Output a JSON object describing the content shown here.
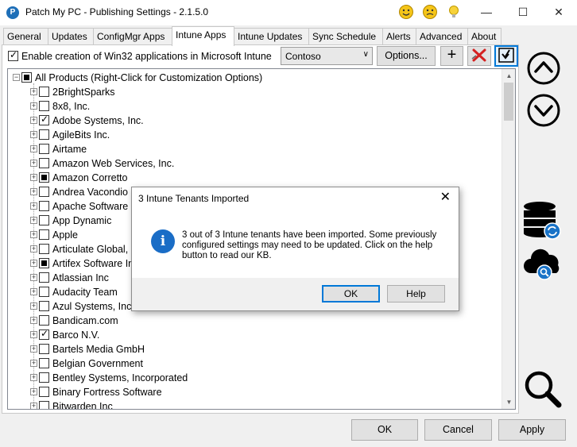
{
  "window": {
    "title": "Patch My PC - Publishing Settings - 2.1.5.0",
    "icon": "patchmypc-logo-icon",
    "controls": [
      "minimize",
      "maximize",
      "close"
    ]
  },
  "tabs": [
    {
      "label": "General"
    },
    {
      "label": "Updates"
    },
    {
      "label": "ConfigMgr Apps"
    },
    {
      "label": "Intune Apps",
      "active": true
    },
    {
      "label": "Intune Updates"
    },
    {
      "label": "Sync Schedule"
    },
    {
      "label": "Alerts"
    },
    {
      "label": "Advanced"
    },
    {
      "label": "About"
    }
  ],
  "toolbar": {
    "enable_label": "Enable creation of Win32 applications in Microsoft Intune",
    "enable_checked": true,
    "tenant_value": "Contoso",
    "options_label": "Options...",
    "add_symbol": "+"
  },
  "tree": {
    "root_label": "All Products (Right-Click for Customization Options)",
    "items": [
      {
        "label": "2BrightSparks",
        "state": "unchecked"
      },
      {
        "label": "8x8, Inc.",
        "state": "unchecked"
      },
      {
        "label": "Adobe Systems, Inc.",
        "state": "checked"
      },
      {
        "label": "AgileBits Inc.",
        "state": "unchecked"
      },
      {
        "label": "Airtame",
        "state": "unchecked"
      },
      {
        "label": "Amazon Web Services, Inc.",
        "state": "unchecked"
      },
      {
        "label": "Amazon Corretto",
        "state": "partial"
      },
      {
        "label": "Andrea Vacondio",
        "state": "unchecked"
      },
      {
        "label": "Apache Software",
        "state": "unchecked"
      },
      {
        "label": "App Dynamic",
        "state": "unchecked"
      },
      {
        "label": "Apple",
        "state": "unchecked"
      },
      {
        "label": "Articulate Global,",
        "state": "unchecked"
      },
      {
        "label": "Artifex Software In",
        "state": "partial"
      },
      {
        "label": "Atlassian Inc",
        "state": "unchecked"
      },
      {
        "label": "Audacity Team",
        "state": "unchecked"
      },
      {
        "label": "Azul Systems, Inc.",
        "state": "unchecked"
      },
      {
        "label": "Bandicam.com",
        "state": "unchecked"
      },
      {
        "label": "Barco N.V.",
        "state": "checked"
      },
      {
        "label": "Bartels Media GmbH",
        "state": "unchecked"
      },
      {
        "label": "Belgian Government",
        "state": "unchecked"
      },
      {
        "label": "Bentley Systems, Incorporated",
        "state": "unchecked"
      },
      {
        "label": "Binary Fortress Software",
        "state": "unchecked"
      },
      {
        "label": "Bitwarden Inc",
        "state": "unchecked"
      }
    ]
  },
  "footer": {
    "ok_label": "OK",
    "cancel_label": "Cancel",
    "apply_label": "Apply"
  },
  "dialog": {
    "title": "3 Intune Tenants Imported",
    "close_symbol": "✕",
    "icon_glyph": "i",
    "message": "3 out of 3 Intune tenants have been imported. Some previously configured settings may need to be updated. Click on the help button to read our KB.",
    "ok_label": "OK",
    "help_label": "Help"
  },
  "colors": {
    "accent": "#0078d7",
    "info_blue": "#1a6dc6",
    "red_x": "#d42020"
  }
}
